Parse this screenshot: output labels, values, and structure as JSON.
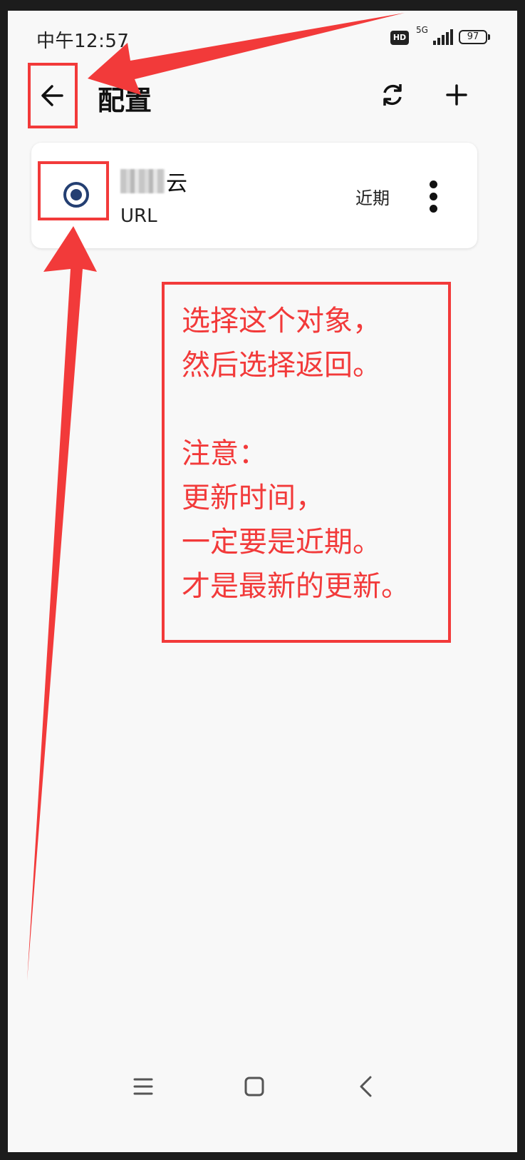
{
  "status_bar": {
    "time": "中午12:57",
    "network": "5G",
    "hd_badge": "HD",
    "battery": "97"
  },
  "top_bar": {
    "title": "配置",
    "back_icon": "arrow-left-icon",
    "refresh_icon": "sync-icon",
    "add_icon": "plus-icon"
  },
  "profile": {
    "name_suffix": "云",
    "subtitle": "URL",
    "update_time": "近期",
    "selected": true,
    "accent_color": "#243f72"
  },
  "annotation": {
    "color": "#f23a3a",
    "lines": [
      "选择这个对象，",
      "然后选择返回。",
      "",
      "注意：",
      "更新时间，",
      "一定要是近期。",
      "才是最新的更新。"
    ]
  },
  "nav_bar": {
    "icons": [
      "menu-icon",
      "home-icon",
      "back-icon"
    ]
  }
}
